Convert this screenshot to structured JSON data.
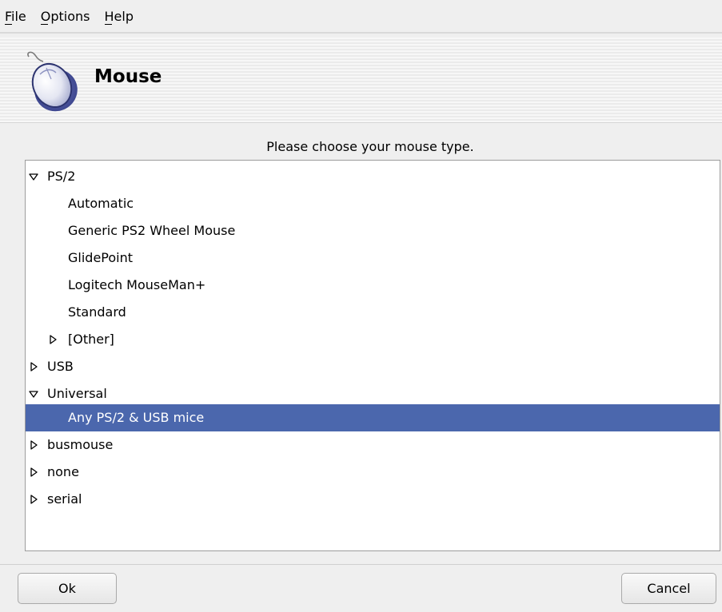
{
  "menubar": {
    "items": [
      {
        "label": "File"
      },
      {
        "label": "Options"
      },
      {
        "label": "Help"
      }
    ]
  },
  "header": {
    "title": "Mouse",
    "icon": "mouse-icon"
  },
  "prompt": "Please choose your mouse type.",
  "tree": {
    "rows": [
      {
        "label": "PS/2",
        "expander": "expanded"
      },
      {
        "label": "Automatic",
        "expander": "none"
      },
      {
        "label": "Generic PS2 Wheel Mouse",
        "expander": "none"
      },
      {
        "label": "GlidePoint",
        "expander": "none"
      },
      {
        "label": "Logitech MouseMan+",
        "expander": "none"
      },
      {
        "label": "Standard",
        "expander": "none"
      },
      {
        "label": "[Other]",
        "expander": "collapsed"
      },
      {
        "label": "USB",
        "expander": "collapsed"
      },
      {
        "label": "Universal",
        "expander": "expanded"
      },
      {
        "label": "Any PS/2 & USB mice",
        "expander": "none",
        "selected": true
      },
      {
        "label": "busmouse",
        "expander": "collapsed"
      },
      {
        "label": "none",
        "expander": "collapsed"
      },
      {
        "label": "serial",
        "expander": "collapsed"
      }
    ],
    "selection_color": "#4b67ad"
  },
  "buttons": {
    "ok": "Ok",
    "cancel": "Cancel"
  }
}
